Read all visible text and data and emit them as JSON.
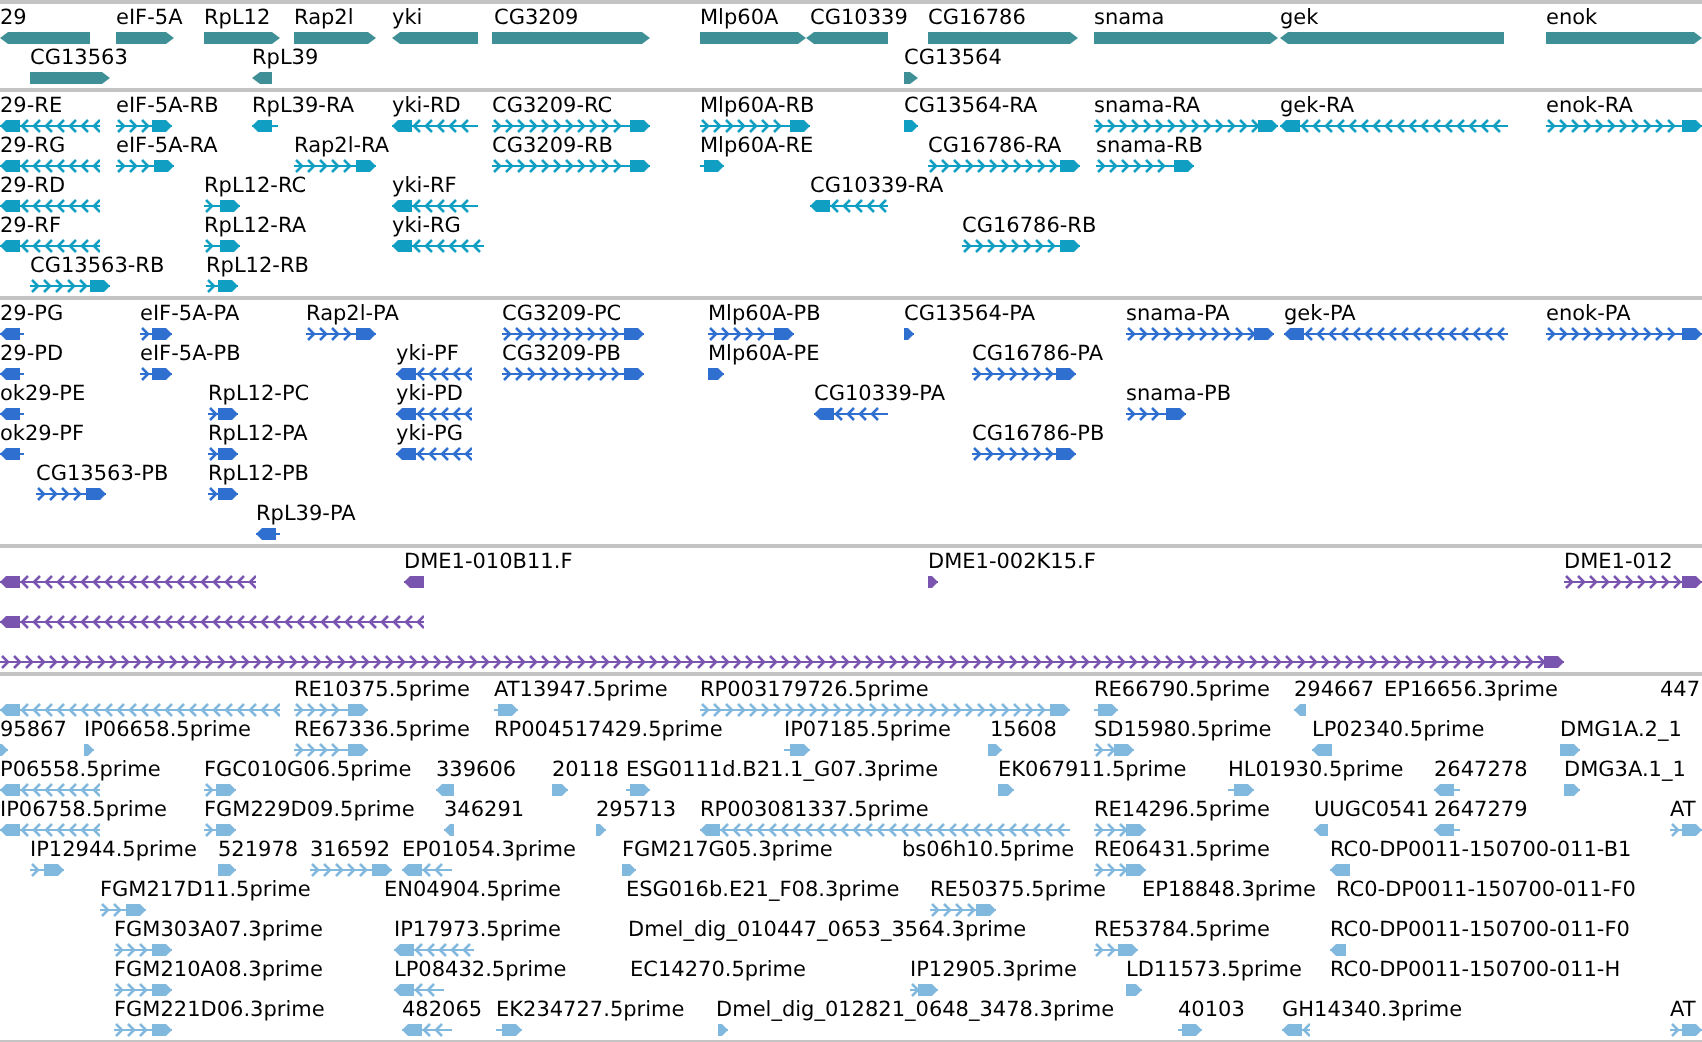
{
  "tracks": [
    {
      "kind": "genes",
      "color": "#3f8f96",
      "features": [
        {
          "label": "29",
          "reverse": true
        },
        {
          "label": "eIF-5A",
          "reverse": false
        },
        {
          "label": "RpL12",
          "reverse": false
        },
        {
          "label": "Rap2l",
          "reverse": false
        },
        {
          "label": "yki",
          "reverse": true
        },
        {
          "label": "CG3209",
          "reverse": false
        },
        {
          "label": "Mlp60A",
          "reverse": false
        },
        {
          "label": "CG10339",
          "reverse": true
        },
        {
          "label": "CG16786",
          "reverse": false
        },
        {
          "label": "snama",
          "reverse": false
        },
        {
          "label": "gek",
          "reverse": true
        },
        {
          "label": "enok",
          "reverse": false
        },
        {
          "label": "CG13563",
          "reverse": false
        },
        {
          "label": "RpL39",
          "reverse": true
        },
        {
          "label": "CG13564",
          "reverse": false
        }
      ]
    },
    {
      "kind": "transcripts",
      "color": "#109fc3",
      "features": [
        {
          "label": "29-RE",
          "reverse": true
        },
        {
          "label": "eIF-5A-RB",
          "reverse": false
        },
        {
          "label": "RpL39-RA",
          "reverse": true
        },
        {
          "label": "yki-RD",
          "reverse": true
        },
        {
          "label": "CG3209-RC",
          "reverse": false
        },
        {
          "label": "Mlp60A-RB",
          "reverse": false
        },
        {
          "label": "CG13564-RA",
          "reverse": false
        },
        {
          "label": "snama-RA",
          "reverse": false
        },
        {
          "label": "gek-RA",
          "reverse": true
        },
        {
          "label": "enok-RA",
          "reverse": false
        },
        {
          "label": "29-RG",
          "reverse": true
        },
        {
          "label": "eIF-5A-RA",
          "reverse": false
        },
        {
          "label": "Rap2l-RA",
          "reverse": false
        },
        {
          "label": "CG3209-RB",
          "reverse": false
        },
        {
          "label": "Mlp60A-RE",
          "reverse": false
        },
        {
          "label": "CG16786-RA",
          "reverse": false
        },
        {
          "label": "snama-RB",
          "reverse": false
        },
        {
          "label": "29-RD",
          "reverse": true
        },
        {
          "label": "RpL12-RC",
          "reverse": false
        },
        {
          "label": "yki-RF",
          "reverse": true
        },
        {
          "label": "CG10339-RA",
          "reverse": true
        },
        {
          "label": "29-RF",
          "reverse": true
        },
        {
          "label": "RpL12-RA",
          "reverse": false
        },
        {
          "label": "yki-RG",
          "reverse": true
        },
        {
          "label": "CG16786-RB",
          "reverse": false
        },
        {
          "label": "CG13563-RB",
          "reverse": false
        },
        {
          "label": "RpL12-RB",
          "reverse": false
        }
      ]
    },
    {
      "kind": "proteins",
      "color": "#2f6fd0",
      "features": [
        {
          "label": "29-PG",
          "reverse": true
        },
        {
          "label": "eIF-5A-PA",
          "reverse": false
        },
        {
          "label": "Rap2l-PA",
          "reverse": false
        },
        {
          "label": "CG3209-PC",
          "reverse": false
        },
        {
          "label": "Mlp60A-PB",
          "reverse": false
        },
        {
          "label": "CG13564-PA",
          "reverse": false
        },
        {
          "label": "snama-PA",
          "reverse": false
        },
        {
          "label": "gek-PA",
          "reverse": true
        },
        {
          "label": "enok-PA",
          "reverse": false
        },
        {
          "label": "29-PD",
          "reverse": true
        },
        {
          "label": "eIF-5A-PB",
          "reverse": false
        },
        {
          "label": "yki-PF",
          "reverse": true
        },
        {
          "label": "CG3209-PB",
          "reverse": false
        },
        {
          "label": "Mlp60A-PE",
          "reverse": false
        },
        {
          "label": "CG16786-PA",
          "reverse": false
        },
        {
          "label": "ok29-PE",
          "reverse": true
        },
        {
          "label": "RpL12-PC",
          "reverse": false
        },
        {
          "label": "yki-PD",
          "reverse": true
        },
        {
          "label": "CG10339-PA",
          "reverse": true
        },
        {
          "label": "snama-PB",
          "reverse": false
        },
        {
          "label": "ok29-PF",
          "reverse": true
        },
        {
          "label": "RpL12-PA",
          "reverse": false
        },
        {
          "label": "yki-PG",
          "reverse": true
        },
        {
          "label": "CG16786-PB",
          "reverse": false
        },
        {
          "label": "CG13563-PB",
          "reverse": false
        },
        {
          "label": "RpL12-PB",
          "reverse": false
        },
        {
          "label": "RpL39-PA",
          "reverse": true
        }
      ]
    },
    {
      "kind": "clones",
      "color": "#7a55b0",
      "features": [
        {
          "reverse": true
        },
        {
          "label": "DME1-010B11.F",
          "reverse": true
        },
        {
          "label": "DME1-002K15.F",
          "reverse": false
        },
        {
          "label": "DME1-012",
          "reverse": false
        },
        {
          "reverse": true
        },
        {
          "reverse": false
        }
      ]
    },
    {
      "kind": "ests",
      "color": "#80b8de",
      "features": [
        {
          "reverse": true
        },
        {
          "label": "RE10375.5prime",
          "reverse": false
        },
        {
          "label": "AT13947.5prime",
          "reverse": false
        },
        {
          "label": "RP003179726.5prime",
          "reverse": false
        },
        {
          "label": "RE66790.5prime",
          "reverse": false
        },
        {
          "label": "294667",
          "reverse": true
        },
        {
          "label": "EP16656.3prime"
        },
        {
          "label": "447"
        },
        {
          "label": "95867",
          "reverse": false
        },
        {
          "label": "IP06658.5prime",
          "reverse": false
        },
        {
          "label": "RE67336.5prime",
          "reverse": false
        },
        {
          "label": "RP004517429.5prime"
        },
        {
          "label": "IP07185.5prime",
          "reverse": false
        },
        {
          "label": "15608",
          "reverse": false
        },
        {
          "label": "SD15980.5prime",
          "reverse": false
        },
        {
          "label": "LP02340.5prime",
          "reverse": true
        },
        {
          "label": "DMG1A.2_1",
          "reverse": false
        },
        {
          "label": "P06558.5prime",
          "reverse": true
        },
        {
          "label": "FGC010G06.5prime",
          "reverse": false
        },
        {
          "label": "339606",
          "reverse": true
        },
        {
          "label": "20118",
          "reverse": false
        },
        {
          "label": "ESG0111d.B21.1_G07.3prime",
          "reverse": false
        },
        {
          "label": "EK067911.5prime",
          "reverse": false
        },
        {
          "label": "HL01930.5prime",
          "reverse": false
        },
        {
          "label": "2647278",
          "reverse": true
        },
        {
          "label": "DMG3A.1_1",
          "reverse": false
        },
        {
          "label": "IP06758.5prime",
          "reverse": true
        },
        {
          "label": "FGM229D09.5prime",
          "reverse": false
        },
        {
          "label": "346291",
          "reverse": true
        },
        {
          "label": "295713",
          "reverse": false
        },
        {
          "label": "RP003081337.5prime",
          "reverse": true
        },
        {
          "label": "RE14296.5prime",
          "reverse": false
        },
        {
          "label": "UUGC0541",
          "reverse": true
        },
        {
          "label": "2647279",
          "reverse": true
        },
        {
          "label": "AT",
          "reverse": false
        },
        {
          "label": "IP12944.5prime",
          "reverse": false
        },
        {
          "label": "521978",
          "reverse": false
        },
        {
          "label": "316592",
          "reverse": false
        },
        {
          "label": "EP01054.3prime",
          "reverse": true
        },
        {
          "label": "FGM217G05.3prime",
          "reverse": false
        },
        {
          "label": "bs06h10.5prime"
        },
        {
          "label": "RE06431.5prime",
          "reverse": false
        },
        {
          "label": "RC0-DP0011-150700-011-B1",
          "reverse": true
        },
        {
          "label": "FGM217D11.5prime",
          "reverse": false
        },
        {
          "label": "EN04904.5prime"
        },
        {
          "label": "ESG016b.E21_F08.3prime"
        },
        {
          "label": "RE50375.5prime",
          "reverse": false
        },
        {
          "label": "EP18848.3prime"
        },
        {
          "label": "RC0-DP0011-150700-011-F0"
        },
        {
          "label": "FGM303A07.3prime",
          "reverse": false
        },
        {
          "label": "IP17973.5prime",
          "reverse": true
        },
        {
          "label": "Dmel_dig_010447_0653_3564.3prime"
        },
        {
          "label": "RE53784.5prime",
          "reverse": false
        },
        {
          "label": "RC0-DP0011-150700-011-F0",
          "reverse": true
        },
        {
          "label": "FGM210A08.3prime",
          "reverse": false
        },
        {
          "label": "LP08432.5prime",
          "reverse": true
        },
        {
          "label": "EC14270.5prime"
        },
        {
          "label": "IP12905.3prime",
          "reverse": false
        },
        {
          "label": "LD11573.5prime",
          "reverse": false
        },
        {
          "label": "RC0-DP0011-150700-011-H"
        },
        {
          "label": "FGM221D06.3prime",
          "reverse": false
        },
        {
          "label": "482065",
          "reverse": true
        },
        {
          "label": "EK234727.5prime",
          "reverse": false
        },
        {
          "label": "Dmel_dig_012821_0648_3478.3prime",
          "reverse": false
        },
        {
          "label": "40103",
          "reverse": false
        },
        {
          "label": "GH14340.3prime",
          "reverse": true
        },
        {
          "label": "AT",
          "reverse": false
        }
      ]
    }
  ]
}
